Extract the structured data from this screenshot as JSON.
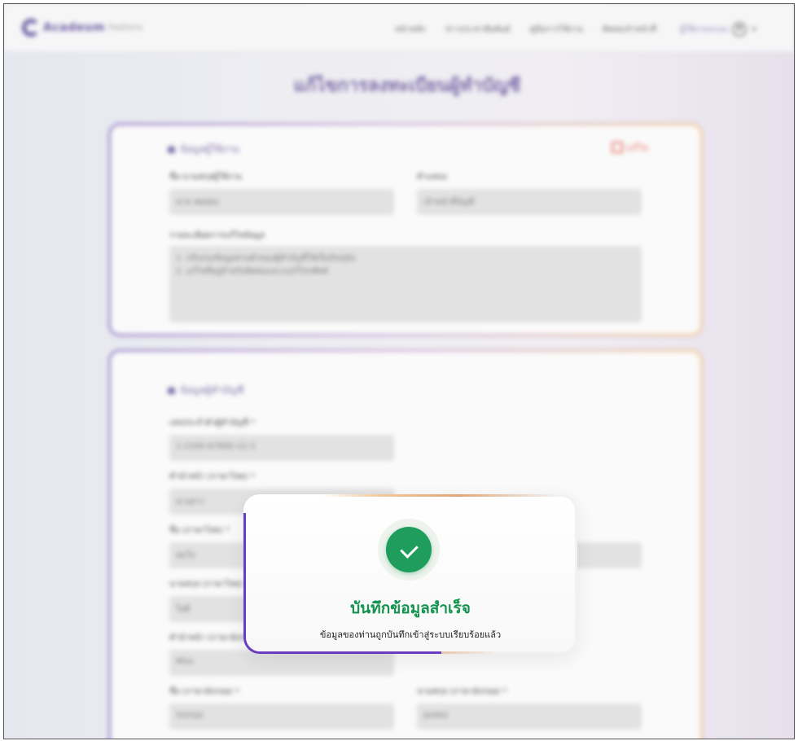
{
  "header": {
    "logo_text": "Acadeum",
    "logo_sub": "Platform",
    "nav": [
      "หน้าหลัก",
      "ข่าวประชาสัมพันธ์",
      "คู่มือการใช้งาน",
      "ติดต่อเจ้าหน้าที่"
    ],
    "user_name": "ผู้ใช้งานระบบ"
  },
  "page": {
    "title": "แก้ไขการลงทะเบียนผู้ทำบัญชี"
  },
  "card1": {
    "section_title": "ข้อมูลผู้ใช้งาน",
    "edit_label": "แก้ไข",
    "label_a": "ชื่อ-นามสกุลผู้ใช้งาน",
    "value_a": "นาย ทดสอบ",
    "label_b": "ตำแหน่ง",
    "value_b": "เจ้าหน้าที่บัญชี",
    "label_c": "รายละเอียดการแก้ไขข้อมูล",
    "text_line1": "1. ปรับปรุงข้อมูลส่วนตัวของผู้ทำบัญชีให้เป็นปัจจุบัน",
    "text_line2": "2. แก้ไขที่อยู่สำหรับติดต่อและเบอร์โทรศัพท์"
  },
  "card2": {
    "section_title": "ข้อมูลผู้ทำบัญชี",
    "label_id": "เลขประจำตัวผู้ทำบัญชี *",
    "value_id": "1-2345-67890-12-3",
    "label_prefix": "คำนำหน้า (ภาษาไทย) *",
    "value_prefix": "นางสาว",
    "label_name_th": "ชื่อ (ภาษาไทย) *",
    "value_name_th": "สมใจ",
    "value_surname_th": "ใจดี",
    "label_surname_th": "นามสกุล (ภาษาไทย) *",
    "value_surname_th2": "ใจดี",
    "label_prefix_en": "คำนำหน้า (ภาษาอังกฤษ) *",
    "value_prefix_en": "Miss",
    "label_name_en": "ชื่อ (ภาษาอังกฤษ) *",
    "value_name_en": "Somjai",
    "label_surname_en": "นามสกุล (ภาษาอังกฤษ) *",
    "value_surname_en": "Jaidee"
  },
  "dialog": {
    "title": "บันทึกข้อมูลสำเร็จ",
    "message": "ข้อมูลของท่านถูกบันทึกเข้าสู่ระบบเรียบร้อยแล้ว"
  },
  "colors": {
    "success_green": "#1e9d5c",
    "accent_purple": "#7a6aa6",
    "edit_red": "#e5705f"
  }
}
